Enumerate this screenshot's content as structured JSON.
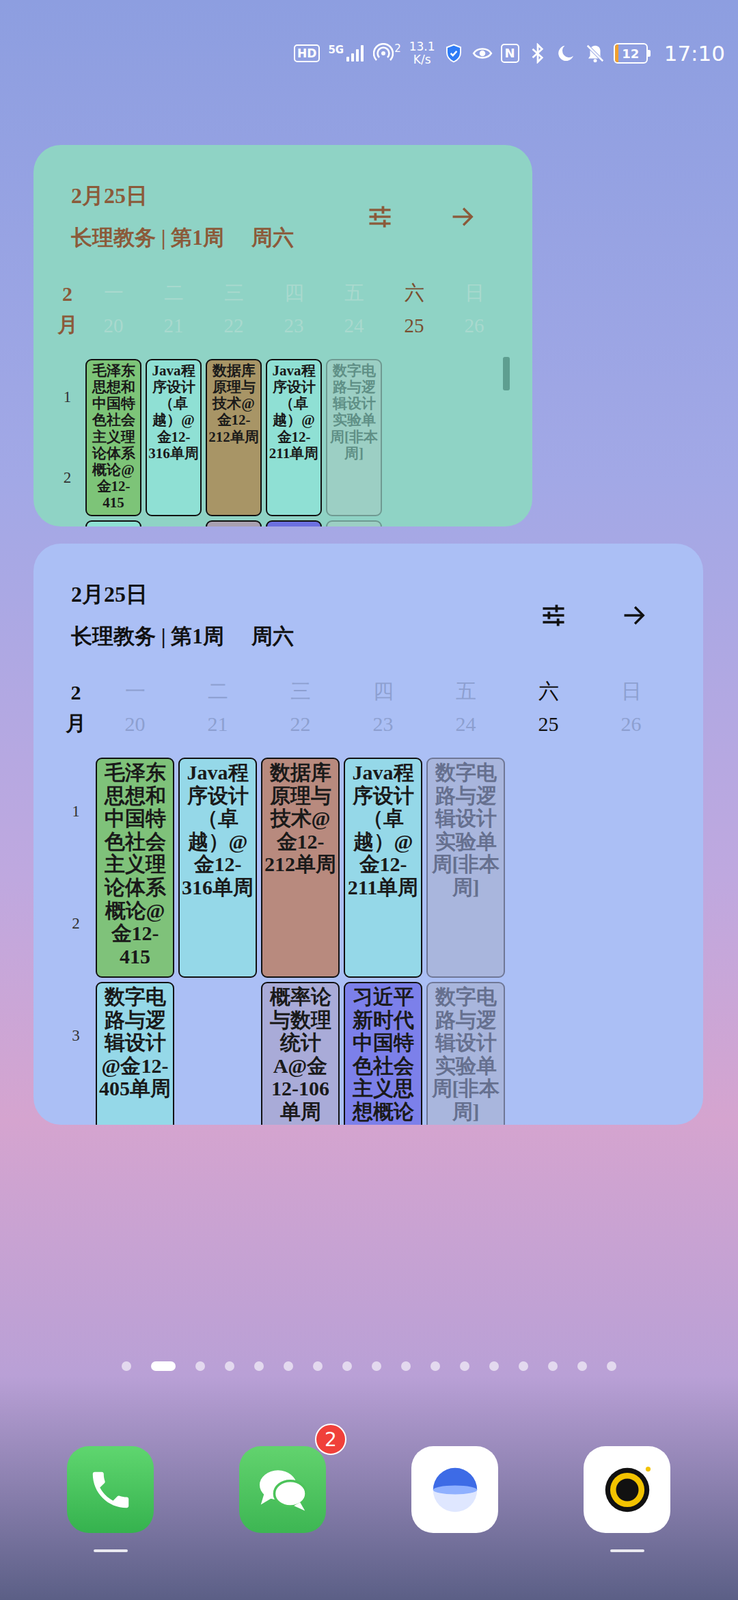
{
  "status_bar": {
    "hd": "HD",
    "network": "5G",
    "hotspot_count": "2",
    "speed_value": "13.1",
    "speed_unit": "K/s",
    "nfc": "N",
    "battery": {
      "level": 0.12,
      "text": "12"
    },
    "time": "17:10"
  },
  "widgets": [
    {
      "date": "2月25日",
      "source": "长理教务 | 第1周",
      "weekday": "周六",
      "month": "2月",
      "scrollbar": true,
      "days": [
        {
          "label": "一",
          "date": "20",
          "selected": false
        },
        {
          "label": "二",
          "date": "21",
          "selected": false
        },
        {
          "label": "三",
          "date": "22",
          "selected": false
        },
        {
          "label": "四",
          "date": "23",
          "selected": false
        },
        {
          "label": "五",
          "date": "24",
          "selected": false
        },
        {
          "label": "六",
          "date": "25",
          "selected": true
        },
        {
          "label": "日",
          "date": "26",
          "selected": false
        }
      ],
      "periods": [
        "1",
        "2"
      ],
      "blocks": [
        {
          "cells": [
            {
              "text": "毛泽东思想和中国特色社会主义理论体系概论@金12-415",
              "color": "#7dc478",
              "faded": false
            },
            {
              "text": "Java程序设计（卓越）@金12-316单周",
              "color": "#8fe0d4",
              "faded": false
            },
            {
              "text": "数据库原理与技术@金12-212单周",
              "color": "#a89566",
              "faded": false
            },
            {
              "text": "Java程序设计（卓越）@金12-211单周",
              "color": "#8fe0d4",
              "faded": false
            },
            {
              "text": "数字电路与逻辑设计实验单周[非本周]",
              "color": "#9ccfc4",
              "faded": true
            },
            null,
            null
          ]
        },
        {
          "cells": [
            {
              "text": "",
              "color": "#8fe0d4",
              "faded": false
            },
            null,
            {
              "text": "",
              "color": "#a8a0b0",
              "faded": false
            },
            {
              "text": "",
              "color": "#6c70e0",
              "faded": false
            },
            {
              "text": "",
              "color": "#9ccfc4",
              "faded": true
            },
            null,
            null
          ]
        }
      ]
    },
    {
      "date": "2月25日",
      "source": "长理教务 | 第1周",
      "weekday": "周六",
      "month": "2月",
      "scrollbar": false,
      "days": [
        {
          "label": "一",
          "date": "20",
          "selected": false
        },
        {
          "label": "二",
          "date": "21",
          "selected": false
        },
        {
          "label": "三",
          "date": "22",
          "selected": false
        },
        {
          "label": "四",
          "date": "23",
          "selected": false
        },
        {
          "label": "五",
          "date": "24",
          "selected": false
        },
        {
          "label": "六",
          "date": "25",
          "selected": true
        },
        {
          "label": "日",
          "date": "26",
          "selected": false
        }
      ],
      "periods": [
        "1",
        "2",
        "3"
      ],
      "blocks": [
        {
          "cells": [
            {
              "text": "毛泽东思想和中国特色社会主义理论体系概论@金12-415",
              "color": "#7fc27a",
              "faded": false
            },
            {
              "text": "Java程序设计（卓越）@金12-316单周",
              "color": "#95d8e8",
              "faded": false
            },
            {
              "text": "数据库原理与技术@金12-212单周",
              "color": "#b88a7e",
              "faded": false
            },
            {
              "text": "Java程序设计（卓越）@金12-211单周",
              "color": "#95d8e8",
              "faded": false
            },
            {
              "text": "数字电路与逻辑设计实验单周[非本周]",
              "color": "#a9b6dd",
              "faded": true
            },
            null,
            null
          ]
        },
        {
          "cells": [
            {
              "text": "数字电路与逻辑设计@金12-405单周",
              "color": "#95d8e8",
              "faded": false
            },
            null,
            {
              "text": "概率论与数理统计A@金12-106单周",
              "color": "#a9abd8",
              "faded": false
            },
            {
              "text": "习近平新时代中国特色社会主义思想概论",
              "color": "#7c80ea",
              "faded": false
            },
            {
              "text": "数字电路与逻辑设计实验单周[非本周]",
              "color": "#a9b6dd",
              "faded": true
            },
            null,
            null
          ]
        }
      ]
    }
  ],
  "pages": [
    {
      "selected": false
    },
    {
      "selected": true
    },
    {
      "selected": false
    },
    {
      "selected": false
    },
    {
      "selected": false
    },
    {
      "selected": false
    },
    {
      "selected": false
    },
    {
      "selected": false
    },
    {
      "selected": false
    },
    {
      "selected": false
    },
    {
      "selected": false
    },
    {
      "selected": false
    },
    {
      "selected": false
    },
    {
      "selected": false
    },
    {
      "selected": false
    },
    {
      "selected": false
    },
    {
      "selected": false
    }
  ],
  "dock": [
    {
      "kind": "phone",
      "badge": "",
      "running": true
    },
    {
      "kind": "messages",
      "badge": "2",
      "running": false
    },
    {
      "kind": "browser",
      "badge": "",
      "running": false
    },
    {
      "kind": "camera",
      "badge": "",
      "running": true
    }
  ]
}
